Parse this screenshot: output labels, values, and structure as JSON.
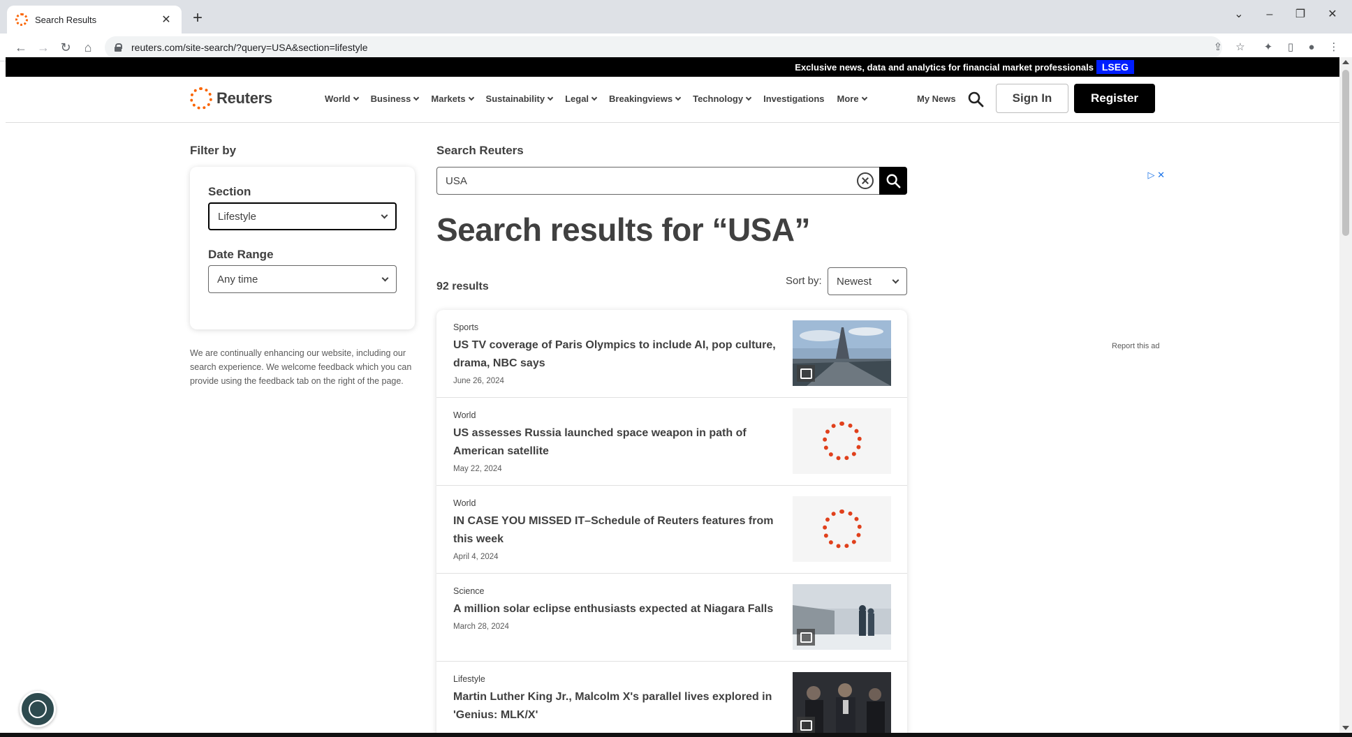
{
  "browser": {
    "tab_title": "Search Results",
    "url": "reuters.com/site-search/?query=USA&section=lifestyle"
  },
  "promo": {
    "text": "Exclusive news, data and analytics for financial market professionals",
    "badge": "LSEG"
  },
  "header": {
    "logo": "Reuters",
    "nav": [
      {
        "label": "World",
        "dropdown": true
      },
      {
        "label": "Business",
        "dropdown": true
      },
      {
        "label": "Markets",
        "dropdown": true
      },
      {
        "label": "Sustainability",
        "dropdown": true
      },
      {
        "label": "Legal",
        "dropdown": true
      },
      {
        "label": "Breakingviews",
        "dropdown": true
      },
      {
        "label": "Technology",
        "dropdown": true
      },
      {
        "label": "Investigations",
        "dropdown": false
      },
      {
        "label": "More",
        "dropdown": true
      }
    ],
    "my_news": "My News",
    "sign_in": "Sign In",
    "register": "Register"
  },
  "filter": {
    "title": "Filter by",
    "section_label": "Section",
    "section_value": "Lifestyle",
    "date_label": "Date Range",
    "date_value": "Any time",
    "note": "We are continually enhancing our website, including our search experience. We welcome feedback which you can provide using the feedback tab on the right of the page."
  },
  "search": {
    "heading": "Search Reuters",
    "query": "USA",
    "results_title": "Search results for “USA”",
    "count": "92 results",
    "sort_label": "Sort by:",
    "sort_value": "Newest"
  },
  "results": [
    {
      "category": "Sports",
      "title": "US TV coverage of Paris Olympics to include AI, pop culture, drama, NBC says",
      "date": "June 26, 2024",
      "thumb": "photo-eiffel"
    },
    {
      "category": "World",
      "title": "US assesses Russia launched space weapon in path of American satellite",
      "date": "May 22, 2024",
      "thumb": "reuters-logo"
    },
    {
      "category": "World",
      "title": "IN CASE YOU MISSED IT–Schedule of Reuters features from this week",
      "date": "April 4, 2024",
      "thumb": "reuters-logo"
    },
    {
      "category": "Science",
      "title": "A million solar eclipse enthusiasts expected at Niagara Falls",
      "date": "March 28, 2024",
      "thumb": "photo-niagara"
    },
    {
      "category": "Lifestyle",
      "title": "Martin Luther King Jr., Malcolm X's parallel lives explored in 'Genius: MLK/X'",
      "date": "",
      "thumb": "photo-crowd"
    }
  ],
  "ad": {
    "report": "Report this ad"
  }
}
